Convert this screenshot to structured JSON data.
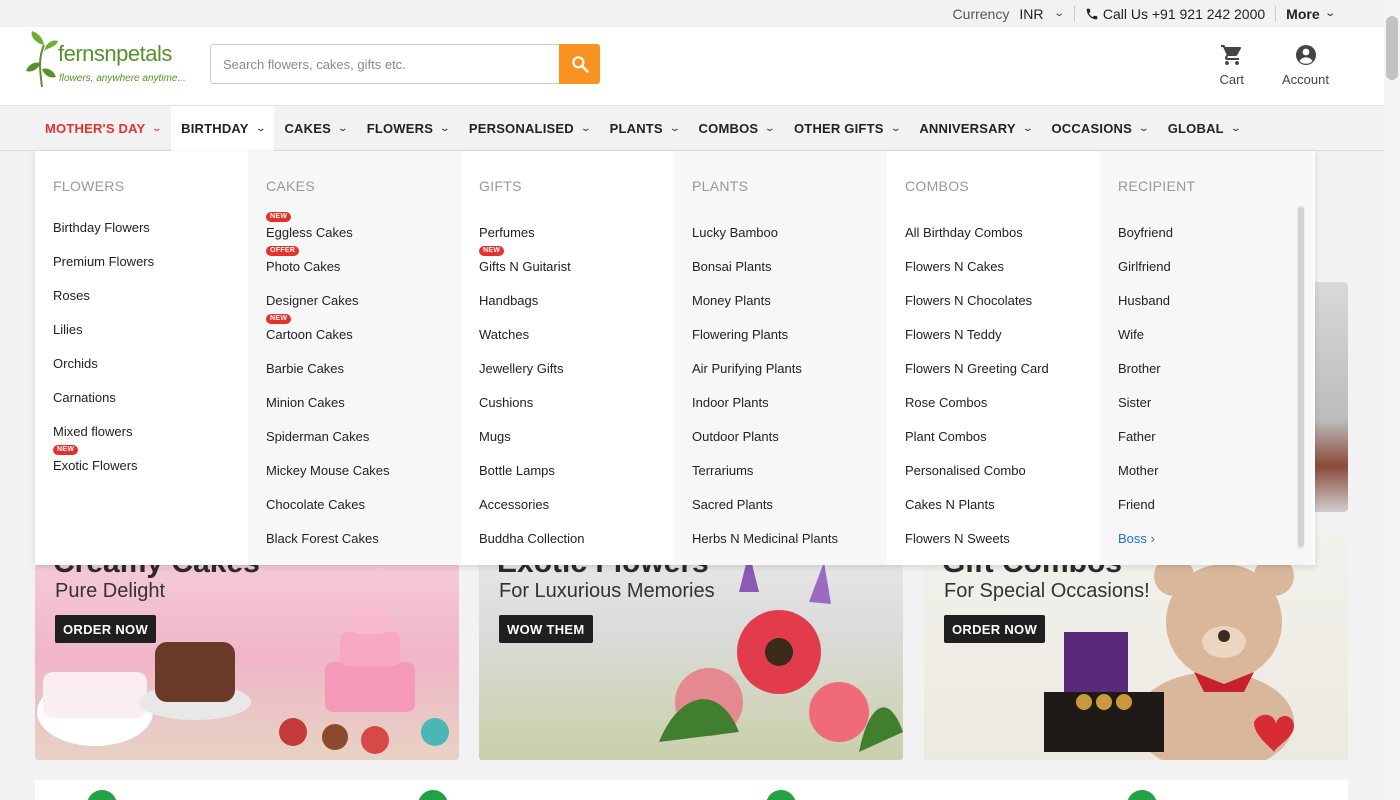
{
  "topbar": {
    "currency_label": "Currency",
    "currency_value": "INR",
    "phone": "Call Us +91 921 242 2000",
    "more": "More"
  },
  "brand": {
    "name": "fernsnpetals",
    "tagline": "flowers, anywhere anytime..."
  },
  "search": {
    "placeholder": "Search flowers, cakes, gifts etc."
  },
  "header_icons": {
    "cart": "Cart",
    "account": "Account"
  },
  "nav": [
    {
      "label": "MOTHER'S DAY"
    },
    {
      "label": "BIRTHDAY"
    },
    {
      "label": "CAKES"
    },
    {
      "label": "FLOWERS"
    },
    {
      "label": "PERSONALISED"
    },
    {
      "label": "PLANTS"
    },
    {
      "label": "COMBOS"
    },
    {
      "label": "OTHER GIFTS"
    },
    {
      "label": "ANNIVERSARY"
    },
    {
      "label": "OCCASIONS"
    },
    {
      "label": "GLOBAL"
    }
  ],
  "mega": {
    "flowers": {
      "title": "FLOWERS",
      "items": [
        "Birthday Flowers",
        "Premium Flowers",
        "Roses",
        "Lilies",
        "Orchids",
        "Carnations",
        "Mixed flowers",
        "Exotic Flowers"
      ],
      "badges": {
        "7": "NEW"
      }
    },
    "cakes": {
      "title": "CAKES",
      "items": [
        "Eggless Cakes",
        "Photo Cakes",
        "Designer Cakes",
        "Cartoon Cakes",
        "Barbie Cakes",
        "Minion Cakes",
        "Spiderman Cakes",
        "Mickey Mouse Cakes",
        "Chocolate Cakes",
        "Black Forest Cakes"
      ],
      "badges": {
        "0": "NEW",
        "1": "OFFER",
        "3": "NEW"
      }
    },
    "gifts": {
      "title": "GIFTS",
      "items": [
        "Perfumes",
        "Gifts N Guitarist",
        "Handbags",
        "Watches",
        "Jewellery Gifts",
        "Cushions",
        "Mugs",
        "Bottle Lamps",
        "Accessories",
        "Buddha Collection"
      ],
      "badges": {
        "1": "NEW"
      }
    },
    "plants": {
      "title": "PLANTS",
      "items": [
        "Lucky Bamboo",
        "Bonsai Plants",
        "Money Plants",
        "Flowering Plants",
        "Air Purifying Plants",
        "Indoor Plants",
        "Outdoor Plants",
        "Terrariums",
        "Sacred Plants",
        "Herbs N Medicinal Plants"
      ]
    },
    "combos": {
      "title": "COMBOS",
      "items": [
        "All Birthday Combos",
        "Flowers N Cakes",
        "Flowers N Chocolates",
        "Flowers N Teddy",
        "Flowers N Greeting Card",
        "Rose Combos",
        "Plant Combos",
        "Personalised Combo",
        "Cakes N Plants",
        "Flowers N Sweets"
      ]
    },
    "recipient": {
      "title": "RECIPIENT",
      "items": [
        "Boyfriend",
        "Girlfriend",
        "Husband",
        "Wife",
        "Brother",
        "Sister",
        "Father",
        "Mother",
        "Friend",
        "Boss"
      ]
    }
  },
  "banners": [
    {
      "title": "Creamy Cakes",
      "subtitle": "Pure Delight",
      "button": "ORDER NOW"
    },
    {
      "title": "Exotic Flowers",
      "subtitle": "For Luxurious Memories",
      "button": "WOW THEM"
    },
    {
      "title": "Gift Combos",
      "subtitle": "For Special Occasions!",
      "button": "ORDER NOW"
    }
  ],
  "colors": {
    "accent_orange": "#f7931e",
    "nav_red": "#e5322d",
    "brand_green": "#5a8f2e",
    "link_blue": "#1e73be"
  }
}
